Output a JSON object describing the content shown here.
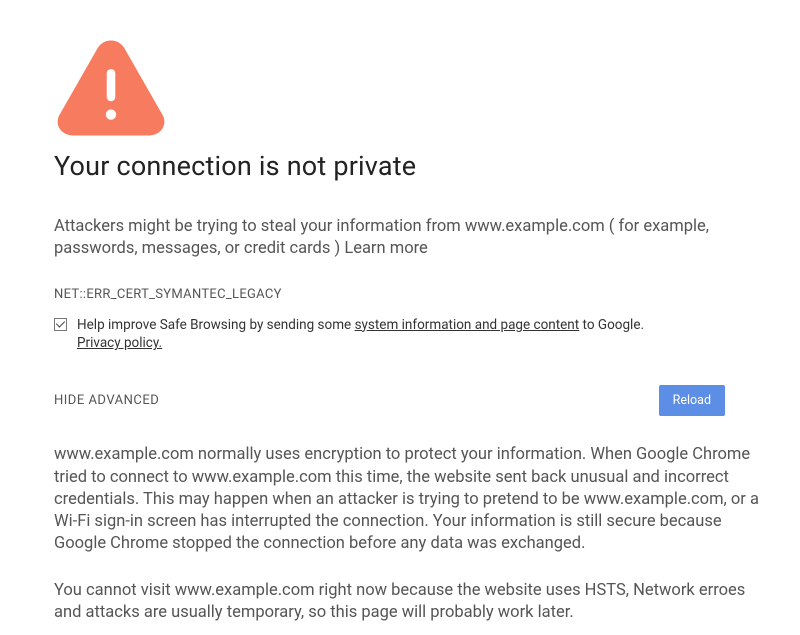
{
  "icon": "warning-triangle",
  "heading": "Your connection is not private",
  "subtext": {
    "before": "Attackers might be trying to steal your information from www.example.com ( for example, passwords, messages, or credit cards ) ",
    "learn_more": "Learn more"
  },
  "error_code": "NET::ERR_CERT_SYMANTEC_LEGACY",
  "opt_in": {
    "checked": true,
    "prefix": "Help improve Safe Browsing by sending some ",
    "link1": "system information and page content",
    "mid": " to Google. ",
    "link2": "Privacy policy."
  },
  "actions": {
    "hide_advanced": "HIDE ADVANCED",
    "reload": "Reload"
  },
  "advanced": {
    "p1": "www.example.com normally uses encryption to protect your information. When Google Chrome tried to connect to www.example.com this time, the website sent back unusual and incorrect credentials. This may happen when an attacker is trying to pretend to be www.example.com, or a Wi-Fi sign-in screen has interrupted the connection. Your information is still secure because Google Chrome stopped the connection before any data was exchanged.",
    "p2": "You cannot visit www.example.com right now because the website uses HSTS, Network erroes and attacks are usually temporary, so this page will probably work later."
  },
  "colors": {
    "warning_icon": "#f77b5f",
    "button_bg": "#5c8ee6"
  }
}
